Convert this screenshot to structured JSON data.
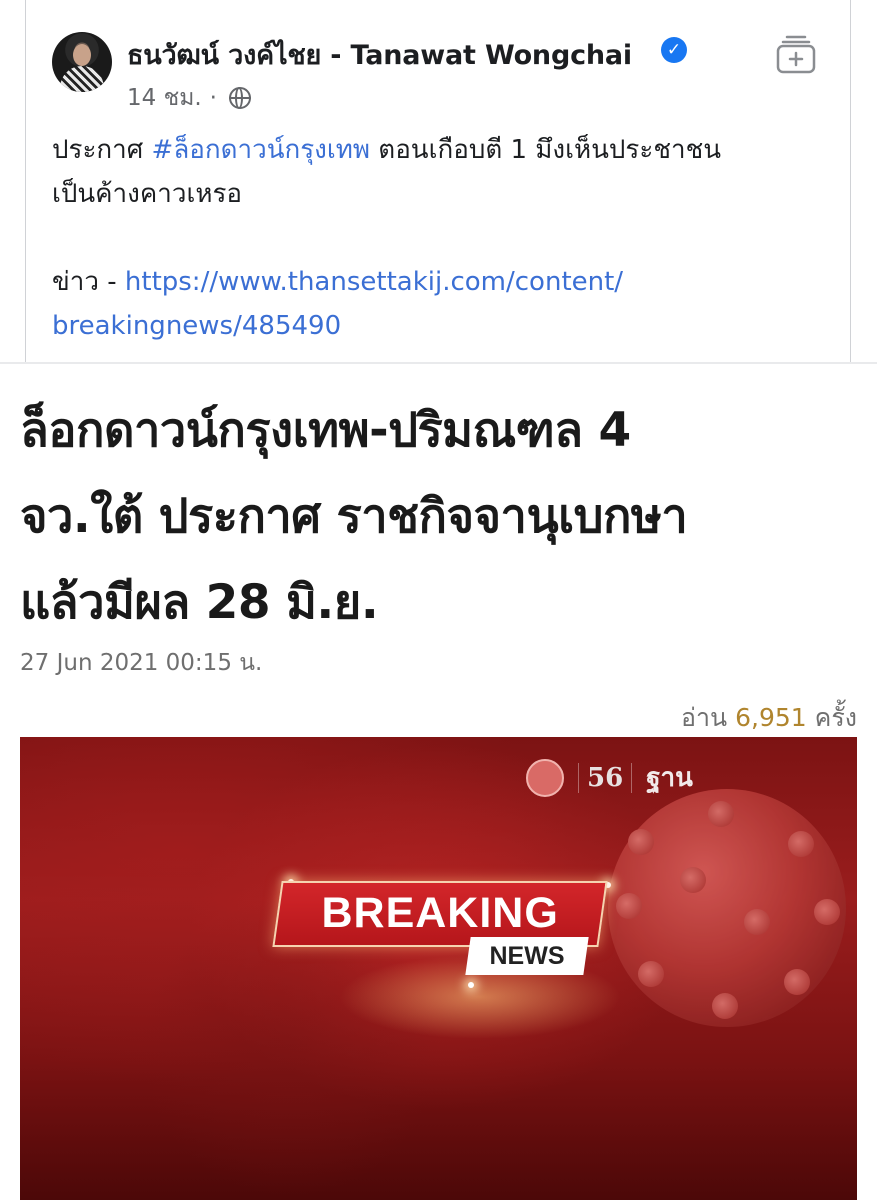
{
  "post": {
    "author": "ธนวัฒน์ วงค์ไชย - Tanawat Wongchai",
    "time": "14 ชม.",
    "dot": "·",
    "text_prefix": "ประกาศ ",
    "hashtag": "#ล็อกดาวน์กรุงเทพ",
    "text_suffix": " ตอนเกือบตี 1 มึงเห็นประชาชน",
    "text_line2": "เป็นค้างคาวเหรอ",
    "news_label": "ข่าว - ",
    "link_line1": "https://www.thansettakij.com/content/",
    "link_line2": "breakingnews/485490",
    "verified_glyph": "✓",
    "icons": [
      "avatar",
      "verified-badge-icon",
      "globe-icon",
      "save-to-collection-icon"
    ]
  },
  "article": {
    "headline_line1": "ล็อกดาวน์กรุงเทพ-ปริมณฑล 4",
    "headline_line2": "จว.ใต้ ประกาศ ราชกิจจานุเบกษา",
    "headline_line3": "แล้วมีผล 28 มิ.ย.",
    "date": "27 Jun 2021 00:15 น.",
    "views_label": "อ่าน",
    "views_count": "6,951",
    "views_unit": "ครั้ง"
  },
  "banner": {
    "breaking": "BREAKING",
    "news": "NEWS",
    "logo_56": "56",
    "logo_than": "ฐาน",
    "colors": {
      "background": "#8e1a1a",
      "breaking_red": "#c81e22",
      "link_blue": "#3b6fd4",
      "views_gold": "#b0852e"
    }
  }
}
